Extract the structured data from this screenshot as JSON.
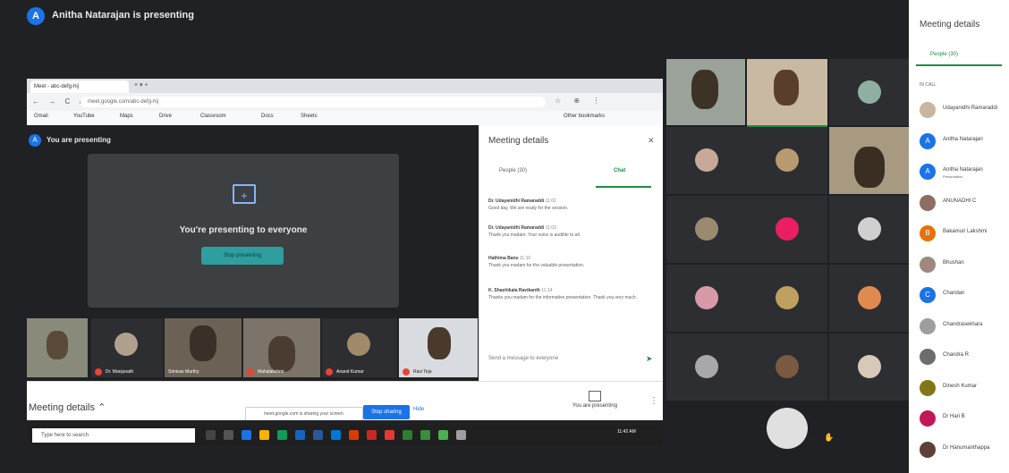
{
  "top_bar": {
    "avatar_letter": "A",
    "presenting_text": "Anitha Natarajan is presenting"
  },
  "browser": {
    "tab_title": "Meet - abc-defg-hij",
    "tab_controls": "× ▾ +",
    "nav": "← → C ⌂",
    "url": "meet.google.com/abc-defg-hij",
    "toolbar_icons": "☆ ⊕ ⋮",
    "bookmarks": [
      "Gmail",
      "YouTube",
      "Maps",
      "Drive",
      "Classroom",
      "Docs",
      "Sheets",
      "Other bookmarks"
    ]
  },
  "shared_meet": {
    "avatar_letter": "A",
    "header": "You are presenting",
    "present_icon": "+",
    "present_title": "You're presenting to everyone",
    "stop_button": "Stop presenting",
    "strip_names": [
      "",
      "Dr. Manjunath",
      "Srinivas Murthy",
      "Mahalakshmi",
      "Anand Kumar",
      "Ravi Teja"
    ],
    "meeting_details_label": "Meeting details",
    "caret": "⌃",
    "pill_text": "meet.google.com is sharing your screen.",
    "pill_button": "Stop sharing",
    "pill_hide": "Hide",
    "you_presenting": "You are presenting",
    "more_dots": "⋮"
  },
  "chat_panel": {
    "title": "Meeting details",
    "close": "✕",
    "tab_people": "People (30)",
    "tab_chat": "Chat",
    "messages": [
      {
        "who": "Dr. Udayanidhi Ramaraddi",
        "time": "11:02",
        "text": "Good day. We are ready for the session."
      },
      {
        "who": "Dr. Udayanidhi Ramaraddi",
        "time": "11:03",
        "text": "Thank you madam. Your voice is audible to all."
      },
      {
        "who": "Hathima Banu",
        "time": "11:10",
        "text": "Thank you madam for the valuable presentation."
      },
      {
        "who": "K. Shashikala Ravikanth",
        "time": "11:14",
        "text": "Thanks you madam for the informative presentation. Thank you very much."
      }
    ],
    "input_placeholder": "Send a message to everyone",
    "send": "➤"
  },
  "taskbar": {
    "search_text": "Type here to search",
    "time": "11:42 AM"
  },
  "grid": {
    "self_avatar": "",
    "raise_hand": "✋"
  },
  "participants_panel": {
    "title": "Meeting details",
    "tab": "People (30)",
    "section": "IN CALL",
    "people": [
      {
        "initial": "",
        "name": "Udayanidhi Ramaraddi",
        "sub": "",
        "color": "#c9b5a0"
      },
      {
        "initial": "A",
        "name": "Anitha Natarajan",
        "sub": "",
        "color": "#1a73e8"
      },
      {
        "initial": "A",
        "name": "Anitha Natarajan",
        "sub": "Presentation",
        "color": "#1a73e8"
      },
      {
        "initial": "",
        "name": "ANUNADHI C",
        "sub": "",
        "color": "#8d6e63"
      },
      {
        "initial": "B",
        "name": "Bakamuri Lakshmi",
        "sub": "",
        "color": "#e8710a"
      },
      {
        "initial": "",
        "name": "Bhushan",
        "sub": "",
        "color": "#a1887f"
      },
      {
        "initial": "C",
        "name": "Chandan",
        "sub": "",
        "color": "#1a73e8"
      },
      {
        "initial": "",
        "name": "Chandrasekhara",
        "sub": "",
        "color": "#9e9e9e"
      },
      {
        "initial": "",
        "name": "Chandra R",
        "sub": "",
        "color": "#6d6d6d"
      },
      {
        "initial": "",
        "name": "Dinesh Kumar",
        "sub": "",
        "color": "#827717"
      },
      {
        "initial": "",
        "name": "Dr Hari B",
        "sub": "",
        "color": "#c2185b"
      },
      {
        "initial": "",
        "name": "Dr Hanumanthappa",
        "sub": "",
        "color": "#5d4037"
      }
    ]
  },
  "colors": {
    "meet_bg": "#202124",
    "accent_green": "#1e8e3e",
    "accent_blue": "#1a73e8",
    "teal_button": "#2f9e9e"
  }
}
